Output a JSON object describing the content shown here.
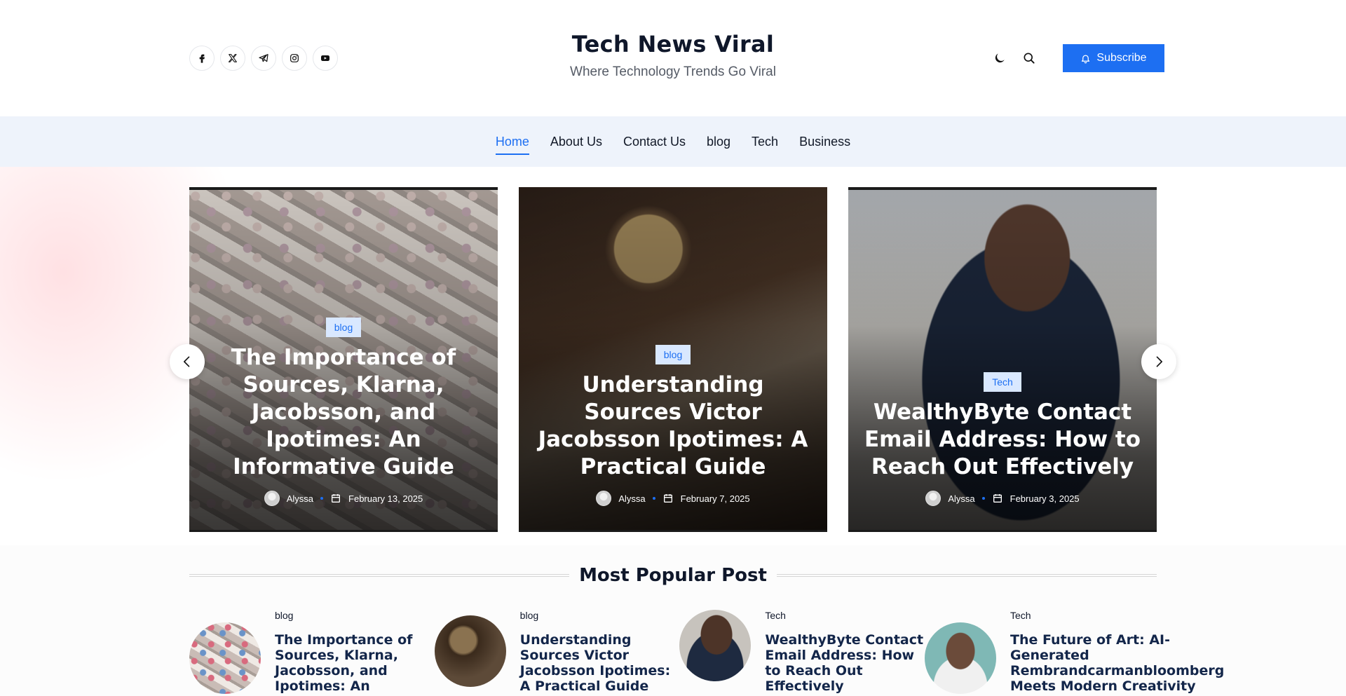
{
  "header": {
    "title": "Tech News Viral",
    "tagline": "Where Technology Trends Go Viral",
    "subscribe_label": "Subscribe",
    "social": [
      "facebook-icon",
      "x-icon",
      "telegram-icon",
      "instagram-icon",
      "youtube-icon"
    ]
  },
  "nav": {
    "items": [
      {
        "label": "Home",
        "active": true
      },
      {
        "label": "About Us"
      },
      {
        "label": "Contact Us"
      },
      {
        "label": "blog"
      },
      {
        "label": "Tech"
      },
      {
        "label": "Business"
      }
    ]
  },
  "slides": [
    {
      "category": "blog",
      "title": "The Importance of Sources, Klarna, Jacobsson, and Ipotimes: An Informative Guide",
      "author": "Alyssa",
      "date": "February 13, 2025"
    },
    {
      "category": "blog",
      "title": "Understanding Sources Victor Jacobsson Ipotimes: A Practical Guide",
      "author": "Alyssa",
      "date": "February 7, 2025"
    },
    {
      "category": "Tech",
      "title": "WealthyByte Contact Email Address: How to Reach Out Effectively",
      "author": "Alyssa",
      "date": "February 3, 2025"
    }
  ],
  "popular": {
    "heading": "Most Popular Post",
    "items": [
      {
        "category": "blog",
        "title": "The Importance of Sources, Klarna, Jacobsson, and Ipotimes: An Informative Guide"
      },
      {
        "category": "blog",
        "title": "Understanding Sources Victor Jacobsson Ipotimes: A Practical Guide"
      },
      {
        "category": "Tech",
        "title": "WealthyByte Contact Email Address: How to Reach Out Effectively"
      },
      {
        "category": "Tech",
        "title": "The Future of Art: AI-Generated Rembrandcarmanbloomberg Meets Modern Creativity"
      }
    ]
  },
  "colors": {
    "accent": "#1d6ff2",
    "nav_bg": "#eef3fb",
    "badge_bg": "#d9e8ff",
    "heading": "#0f172a"
  }
}
